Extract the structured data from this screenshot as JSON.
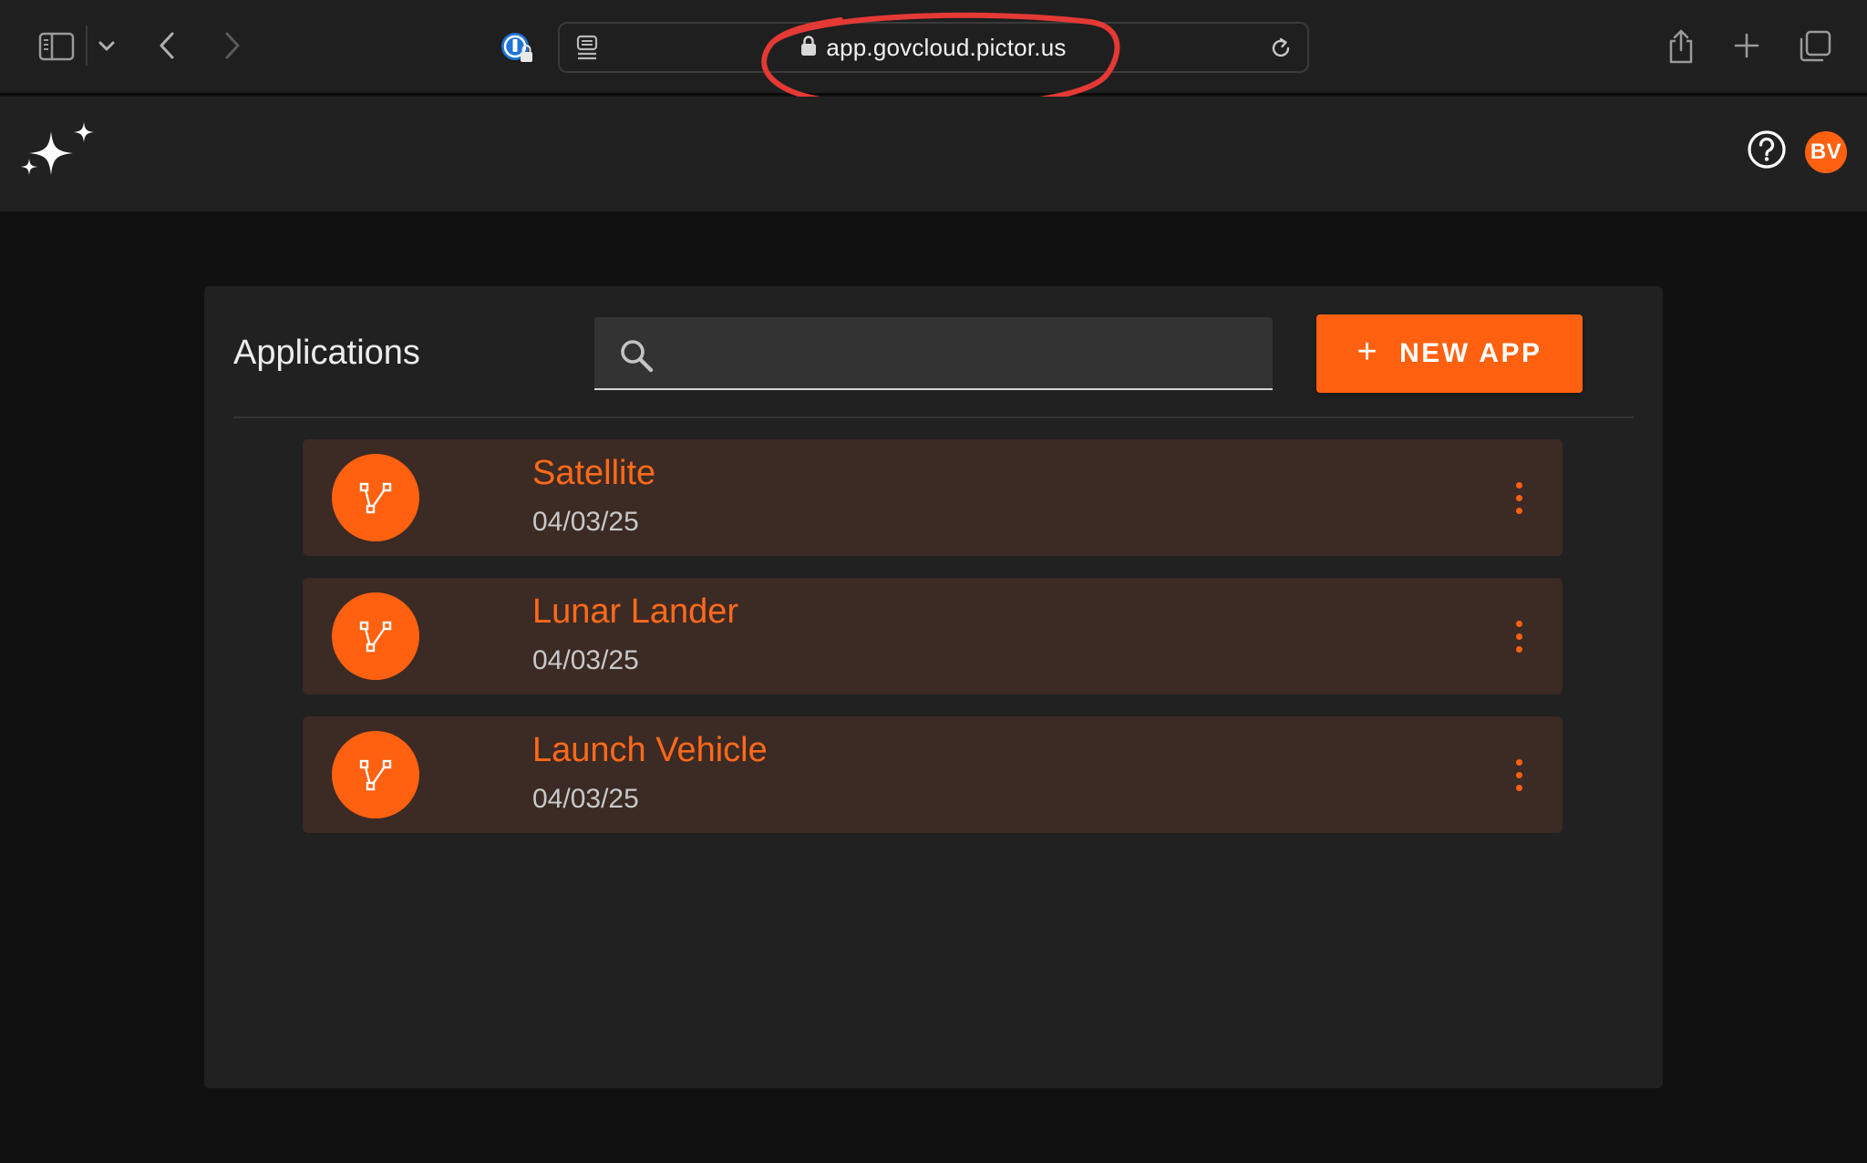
{
  "browser": {
    "url": "app.govcloud.pictor.us"
  },
  "header": {
    "avatar_initials": "BV"
  },
  "main": {
    "title": "Applications",
    "search": {
      "value": "",
      "placeholder": ""
    },
    "new_app_label": "NEW APP",
    "apps": [
      {
        "name": "Satellite",
        "date": "04/03/25"
      },
      {
        "name": "Lunar Lander",
        "date": "04/03/25"
      },
      {
        "name": "Launch Vehicle",
        "date": "04/03/25"
      }
    ]
  },
  "icons": {
    "app_icon": "branch-icon",
    "menu": "more-vert-icon"
  },
  "colors": {
    "accent": "#ff6110",
    "card_bg": "#3c2a24",
    "panel_bg": "#212121",
    "page_bg": "#111111",
    "annotation": "#e53935"
  }
}
